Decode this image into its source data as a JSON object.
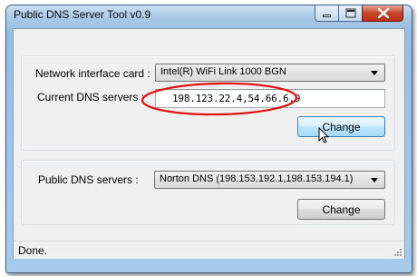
{
  "window": {
    "title": "Public DNS Server Tool v0.9"
  },
  "network": {
    "nic_label": "Network interface card :",
    "nic_value": "Intel(R) WiFi Link 1000 BGN",
    "current_dns_label": "Current DNS servers :",
    "current_dns_value": "198.123.22.4,54.66.6.9",
    "change_label": "Change"
  },
  "public": {
    "label": "Public DNS servers :",
    "value": "Norton DNS (198.153.192.1,198.153.194.1)",
    "change_label": "Change"
  },
  "status": {
    "text": "Done."
  },
  "colors": {
    "annotation": "#e01010",
    "title_bar": "#a9c8e6",
    "close_button": "#c7442a"
  },
  "icons": [
    "minimize-icon",
    "maximize-icon",
    "close-icon",
    "mouse-cursor-icon",
    "size-grip-icon"
  ]
}
